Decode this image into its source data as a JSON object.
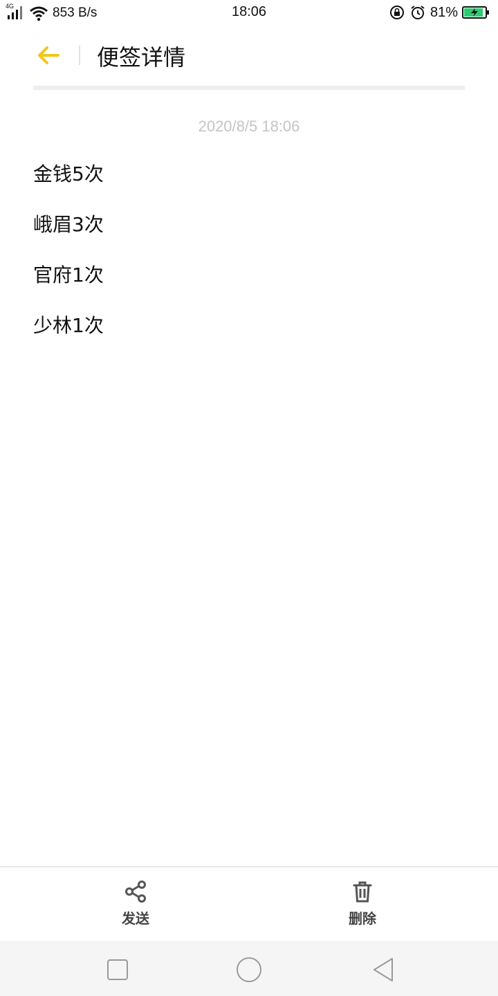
{
  "status_bar": {
    "network": "4G",
    "net_speed": "853 B/s",
    "time": "18:06",
    "battery_percent": "81%",
    "icons": [
      "signal-icon",
      "wifi-icon",
      "rotation-lock-icon",
      "alarm-icon",
      "battery-charging-icon"
    ],
    "battery_level": 0.81
  },
  "header": {
    "title": "便签详情",
    "back_icon": "arrow-left-icon",
    "accent_color": "#F5C518"
  },
  "note": {
    "timestamp": "2020/8/5 18:06",
    "lines": [
      "金钱5次",
      "峨眉3次",
      "官府1次",
      "少林1次"
    ]
  },
  "toolbar": {
    "send": {
      "label": "发送",
      "icon": "share-icon"
    },
    "delete": {
      "label": "删除",
      "icon": "trash-icon"
    }
  },
  "nav_bar": {
    "buttons": [
      "recents-square-icon",
      "home-circle-icon",
      "back-triangle-icon"
    ]
  }
}
